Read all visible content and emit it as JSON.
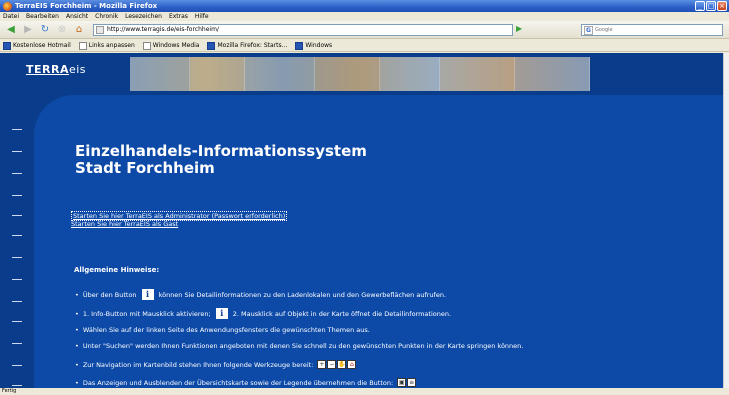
{
  "window": {
    "title": "TerraEIS Forchheim - Mozilla Firefox",
    "buttons": [
      "_",
      "□",
      "×"
    ]
  },
  "menu": [
    "Datei",
    "Bearbeiten",
    "Ansicht",
    "Chronik",
    "Lesezeichen",
    "Extras",
    "Hilfe"
  ],
  "nav": {
    "url": "http://www.terragis.de/eis-forchheim/",
    "search_placeholder": "Google"
  },
  "bookmarks": [
    {
      "label": "Kostenlose Hotmail",
      "icon": "msn-icon"
    },
    {
      "label": "Links anpassen",
      "icon": "page-icon"
    },
    {
      "label": "Windows Media",
      "icon": "page-icon"
    },
    {
      "label": "Mozilla Firefox: Starts...",
      "icon": "page-icon"
    },
    {
      "label": "Windows",
      "icon": "msn-icon"
    }
  ],
  "page": {
    "logo_terra": "TERRA",
    "logo_eis": "eis",
    "heading_line1": "Einzelhandels-Informationssystem",
    "heading_line2": "Stadt Forchheim",
    "link_admin": "Starten Sie hier TerraEIS als Administrator (Passwort erforderlich)",
    "link_gast": "Starten Sie hier TerraEIS als Gast",
    "section_title": "Allgemeine Hinweise:",
    "hints": {
      "h1_pre": "Über den Button",
      "h1_post": "können Sie Detailinformationen zu den Ladenlokalen und den Gewerbeflächen aufrufen.",
      "h2_pre": "1. Info-Button mit Mausklick aktivieren;",
      "h2_post": "2. Mausklick auf Objekt in der Karte öffnet die Detailinformationen.",
      "h3": "Wählen Sie auf der linken Seite des Anwendungsfensters die gewünschten Themen aus.",
      "h4": "Unter \"Suchen\" werden Ihnen Funktionen angeboten mit denen Sie schnell zu den gewünschten Punkten in der Karte springen können.",
      "h5": "Zur Navigation im Kartenbild stehen Ihnen folgende Werkzeuge bereit:",
      "h6": "Das Anzeigen und Ausblenden der Übersichtskarte sowie der Legende übernehmen die Button:"
    },
    "info_glyph": "i"
  },
  "status": "Fertig",
  "colors": {
    "page_bg": "#0a3c8c",
    "panel_bg": "#0d4aa8"
  }
}
